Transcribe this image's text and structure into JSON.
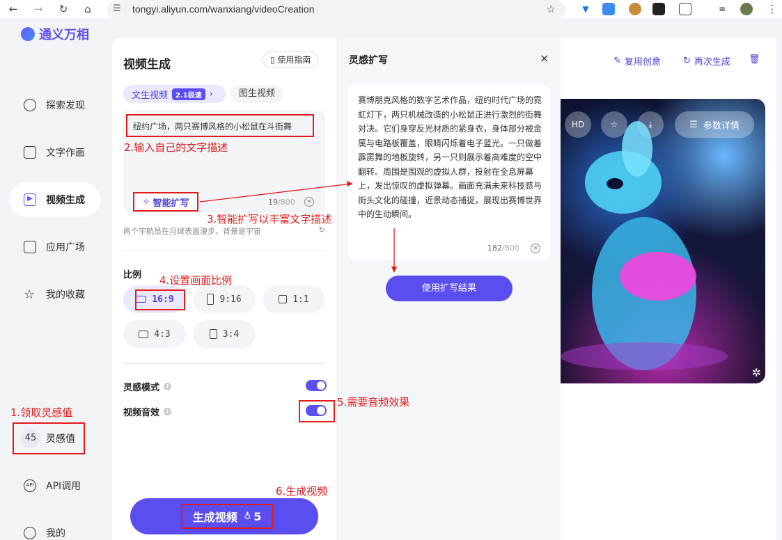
{
  "browser": {
    "url": "tongyi.aliyun.com/wanxiang/videoCreation",
    "back": "←",
    "forward": "→",
    "reload": "↻",
    "home": "⌂",
    "star": "☆",
    "menu": "⋮"
  },
  "sidebar": {
    "brand": "通义万相",
    "items": [
      {
        "label": "探索发现"
      },
      {
        "label": "文字作画"
      },
      {
        "label": "视频生成"
      },
      {
        "label": "应用广场"
      },
      {
        "label": "我的收藏"
      }
    ],
    "credits_value": "45",
    "credits_label": "灵感值",
    "api_label": "API调用",
    "me_label": "我的"
  },
  "panel": {
    "title": "视频生成",
    "guide": "使用指南",
    "tab_active": "文生视频",
    "tab_badge": "2.1极速",
    "tab_other": "图生视频",
    "prompt": "纽约广场，两只赛博风格的小松鼠在斗街舞",
    "smart_expand": "智能扩写",
    "char_count": "19",
    "char_max": "/800",
    "hint": "两个宇航员在月球表面漫步，背景是宇宙",
    "ratio_label": "比例",
    "ratios": [
      "16:9",
      "9:16",
      "1:1",
      "4:3",
      "3:4"
    ],
    "inspiration_mode": "灵感模式",
    "video_audio": "视频音效",
    "generate": "生成视频",
    "generate_cost": "5"
  },
  "inspiration": {
    "title": "灵感扩写",
    "close": "×",
    "text": "赛博朋克风格的数字艺术作品，纽约时代广场的霓虹灯下，两只机械改造的小松鼠正进行激烈的街舞对决。它们身穿反光材质的紧身衣，身体部分被金属与电路板覆盖，眼睛闪烁着电子蓝光。一只做着霹雳舞的地板旋转，另一只则展示着高难度的空中翻转。周围是围观的虚拟人群，投射在全息屏幕上，发出惊叹的虚拟弹幕。画面充满未来科技感与街头文化的碰撞，近景动态捕捉，展现出赛博世界中的生动瞬间。",
    "count": "182",
    "max": "/800",
    "use_button": "使用扩写结果"
  },
  "result": {
    "reuse": "复用创意",
    "regenerate": "再次生成",
    "hd": "HD",
    "params": "参数详情"
  },
  "annotations": {
    "a1": "1.领取灵感值",
    "a2": "2.输入自己的文字描述",
    "a3": "3.智能扩写以丰富文字描述",
    "a4": "4.设置画面比例",
    "a5": "5.需要音频效果",
    "a6": "6.生成视频"
  },
  "colors": {
    "accent": "#5b4ef0",
    "annotation": "#e31b1b"
  }
}
